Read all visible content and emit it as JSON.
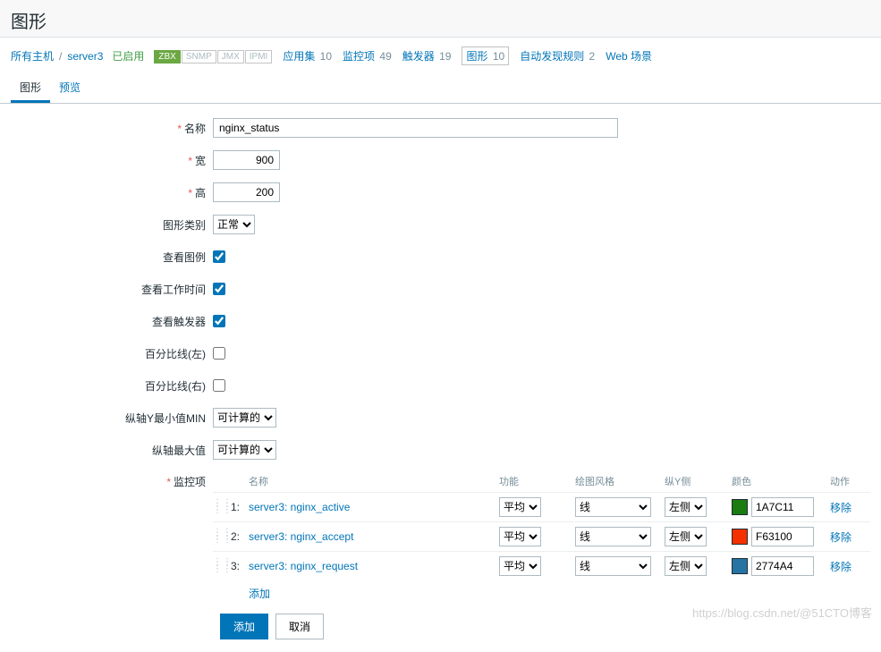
{
  "page_title": "图形",
  "breadcrumb": {
    "all_hosts": "所有主机",
    "host": "server3",
    "enabled": "已启用",
    "tags": {
      "zbx": "ZBX",
      "snmp": "SNMP",
      "jmx": "JMX",
      "ipmi": "IPMI"
    },
    "apps": {
      "label": "应用集",
      "count": "10"
    },
    "items": {
      "label": "监控项",
      "count": "49"
    },
    "triggers": {
      "label": "触发器",
      "count": "19"
    },
    "graphs": {
      "label": "图形",
      "count": "10"
    },
    "discovery": {
      "label": "自动发现规则",
      "count": "2"
    },
    "web": {
      "label": "Web 场景"
    }
  },
  "tabs": {
    "graph": "图形",
    "preview": "预览"
  },
  "form": {
    "name_label": "名称",
    "name_value": "nginx_status",
    "width_label": "宽",
    "width_value": "900",
    "height_label": "高",
    "height_value": "200",
    "type_label": "图形类别",
    "type_value": "正常",
    "legend_label": "查看图例",
    "worktime_label": "查看工作时间",
    "triggers_label": "查看触发器",
    "percl_label": "百分比线(左)",
    "percr_label": "百分比线(右)",
    "ymin_label": "纵轴Y最小值MIN",
    "ymin_value": "可计算的",
    "ymax_label": "纵轴最大值",
    "ymax_value": "可计算的",
    "items_label": "监控项"
  },
  "items_table": {
    "head": {
      "name": "名称",
      "func": "功能",
      "style": "绘图风格",
      "yaxis": "纵Y侧",
      "color": "颜色",
      "action": "动作"
    },
    "func_opt": "平均",
    "style_opt": "线",
    "yaxis_opt": "左侧",
    "remove": "移除",
    "add": "添加",
    "rows": [
      {
        "idx": "1:",
        "name": "server3: nginx_active",
        "color": "1A7C11",
        "hex": "#1A7C11"
      },
      {
        "idx": "2:",
        "name": "server3: nginx_accept",
        "color": "F63100",
        "hex": "#F63100"
      },
      {
        "idx": "3:",
        "name": "server3: nginx_request",
        "color": "2774A4",
        "hex": "#2774A4"
      }
    ]
  },
  "buttons": {
    "add": "添加",
    "cancel": "取消"
  },
  "watermark": "https://blog.csdn.net/@51CTO博客"
}
